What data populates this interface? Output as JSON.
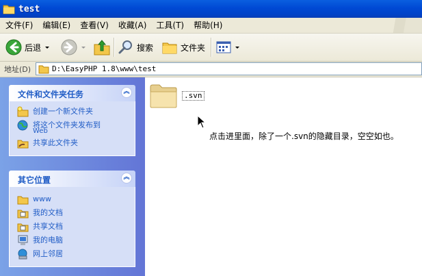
{
  "window": {
    "title": "test"
  },
  "menu": [
    "文件(F)",
    "编辑(E)",
    "查看(V)",
    "收藏(A)",
    "工具(T)",
    "帮助(H)"
  ],
  "toolbar": {
    "back_label": "后退",
    "search_label": "搜索",
    "folders_label": "文件夹"
  },
  "address": {
    "label": "地址(D)",
    "path": "D:\\EasyPHP 1.8\\www\\test"
  },
  "tasks_panel": {
    "title": "文件和文件夹任务",
    "items": [
      {
        "label": "创建一个新文件夹",
        "icon": "new-folder-icon"
      },
      {
        "label": "将这个文件夹发布到",
        "label2": "Web",
        "icon": "publish-web-icon"
      },
      {
        "label": "共享此文件夹",
        "icon": "share-folder-icon"
      }
    ]
  },
  "places_panel": {
    "title": "其它位置",
    "items": [
      {
        "label": "www",
        "icon": "folder-icon"
      },
      {
        "label": "我的文档",
        "icon": "my-documents-icon"
      },
      {
        "label": "共享文档",
        "icon": "shared-documents-icon"
      },
      {
        "label": "我的电脑",
        "icon": "my-computer-icon"
      },
      {
        "label": "网上邻居",
        "icon": "network-places-icon"
      }
    ]
  },
  "files": [
    {
      "name": ".svn",
      "icon": "folder-icon"
    }
  ],
  "annotation": "点击进里面，除了一个.svn的隐藏目录，空空如也。",
  "colors": {
    "titlebar": "#0049d4",
    "link": "#215dc6",
    "sidepane": "#6d89de",
    "chrome": "#ece9d8"
  }
}
